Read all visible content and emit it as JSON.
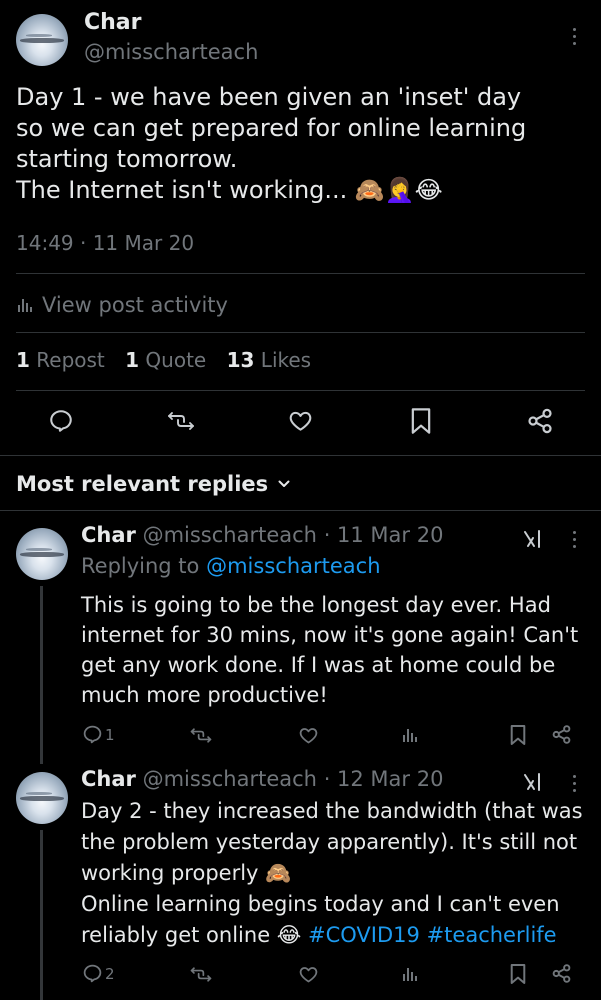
{
  "main_tweet": {
    "display_name": "Char",
    "handle": "@misscharteach",
    "text_lines": [
      "Day 1 - we have been given an 'inset' day",
      "so we can get prepared for online learning",
      "starting tomorrow.",
      "The Internet isn't working... 🙈🤦‍♀️😂"
    ],
    "timestamp": "14:49 · 11 Mar 20",
    "view_activity_label": "View post activity",
    "stats": {
      "reposts_count": "1",
      "reposts_label": "Repost",
      "quotes_count": "1",
      "quotes_label": "Quote",
      "likes_count": "13",
      "likes_label": "Likes"
    }
  },
  "replies_header": {
    "label": "Most relevant replies"
  },
  "replies": [
    {
      "display_name": "Char",
      "handle": "@misscharteach",
      "date": "· 11 Mar 20",
      "replying_to_label": "Replying to",
      "replying_to_handle": "@misscharteach",
      "text_lines": [
        "This is going to be the longest day ever. Had",
        "internet for 30 mins, now it's gone again! Can't",
        "get any work done. If I was at home could be",
        "much more productive!"
      ],
      "reply_count": "1"
    },
    {
      "display_name": "Char",
      "handle": "@misscharteach",
      "date": "· 12 Mar 20",
      "text_lines": [
        "Day 2 - they increased the bandwidth (that was",
        "the problem yesterday apparently). It's still not",
        "working properly 🙈",
        "Online learning begins today and I can't even"
      ],
      "last_line_text": "reliably get online 😂",
      "hashtags": [
        "#COVID19",
        "#teacherlife"
      ],
      "reply_count": "2"
    }
  ],
  "icons": {
    "reply": "reply-icon",
    "repost": "repost-icon",
    "like": "heart-icon",
    "bookmark": "bookmark-icon",
    "share": "share-icon",
    "views": "views-icon",
    "grok": "grok-icon",
    "more": "more-icon",
    "chevron": "chevron-down-icon"
  },
  "colors": {
    "background": "#000000",
    "text": "#e7e9ea",
    "muted": "#71767b",
    "accent": "#1d9bf0"
  }
}
